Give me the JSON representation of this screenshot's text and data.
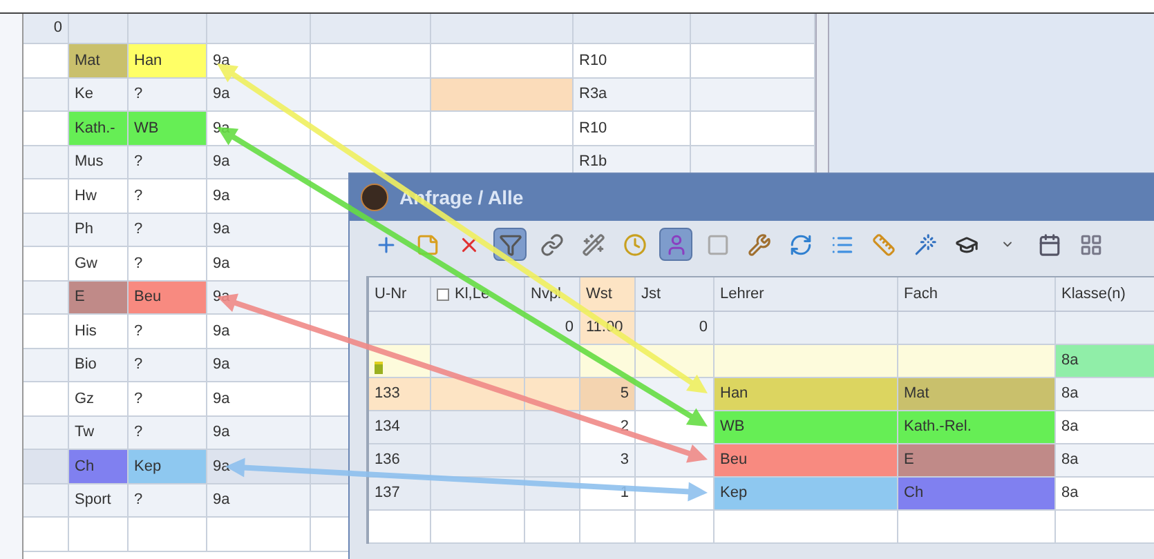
{
  "back_grid": {
    "header_first_cell": "0",
    "rows": [
      {
        "subject": {
          "text": "Mat",
          "color": "#c9c06c"
        },
        "teacher": {
          "text": "Han",
          "color": "#ffff66"
        },
        "class": "9a",
        "room": "R10",
        "selected": false
      },
      {
        "subject": {
          "text": "Ke"
        },
        "teacher": {
          "text": "?"
        },
        "class": "9a",
        "room": "R3a",
        "note_cell": {
          "color": "#fbdcba"
        },
        "selected": false
      },
      {
        "subject": {
          "text": "Kath.-",
          "color": "#66ee55"
        },
        "teacher": {
          "text": "WB",
          "color": "#66ee55"
        },
        "class": "9a",
        "room": "R10",
        "selected": false
      },
      {
        "subject": {
          "text": "Mus"
        },
        "teacher": {
          "text": "?"
        },
        "class": "9a",
        "room": "R1b",
        "selected": false
      },
      {
        "subject": {
          "text": "Hw"
        },
        "teacher": {
          "text": "?"
        },
        "class": "9a",
        "selected": false
      },
      {
        "subject": {
          "text": "Ph"
        },
        "teacher": {
          "text": "?"
        },
        "class": "9a",
        "selected": false
      },
      {
        "subject": {
          "text": "Gw"
        },
        "teacher": {
          "text": "?"
        },
        "class": "9a",
        "selected": false
      },
      {
        "subject": {
          "text": "E",
          "color": "#c08a88"
        },
        "teacher": {
          "text": "Beu",
          "color": "#f88a80"
        },
        "class": "9a",
        "selected": false
      },
      {
        "subject": {
          "text": "His"
        },
        "teacher": {
          "text": "?"
        },
        "class": "9a",
        "selected": false
      },
      {
        "subject": {
          "text": "Bio"
        },
        "teacher": {
          "text": "?"
        },
        "class": "9a",
        "selected": false
      },
      {
        "subject": {
          "text": "Gz"
        },
        "teacher": {
          "text": "?"
        },
        "class": "9a",
        "selected": false
      },
      {
        "subject": {
          "text": "Tw"
        },
        "teacher": {
          "text": "?"
        },
        "class": "9a",
        "selected": false
      },
      {
        "subject": {
          "text": "Ch",
          "color": "#8080f0"
        },
        "teacher": {
          "text": "Kep",
          "color": "#8ec8f0"
        },
        "class": "9a",
        "selected": true
      },
      {
        "subject": {
          "text": "Sport"
        },
        "teacher": {
          "text": "?"
        },
        "class": "9a",
        "selected": false
      },
      {}
    ]
  },
  "window": {
    "title": "Anfrage / Alle",
    "toolbar": [
      {
        "kind": "add",
        "selected": false
      },
      {
        "kind": "note",
        "selected": false
      },
      {
        "kind": "delete",
        "selected": false
      },
      {
        "kind": "filter",
        "selected": true
      },
      {
        "kind": "link",
        "selected": false
      },
      {
        "kind": "wand",
        "selected": false
      },
      {
        "kind": "clock",
        "selected": false
      },
      {
        "kind": "person",
        "selected": true
      },
      {
        "kind": "window",
        "selected": false
      },
      {
        "kind": "tool",
        "selected": false
      },
      {
        "kind": "refresh",
        "selected": false
      },
      {
        "kind": "list",
        "selected": false
      },
      {
        "kind": "ruler",
        "selected": false
      },
      {
        "kind": "wizard",
        "selected": false
      },
      {
        "kind": "hat",
        "selected": false
      },
      {
        "kind": "dropdown",
        "selected": false
      },
      {
        "kind": "calendar",
        "selected": false
      },
      {
        "kind": "grid",
        "selected": false
      }
    ],
    "table": {
      "columns": [
        "U-Nr",
        "Kl,Le",
        "Nvpl",
        "Wst",
        "Jst",
        "Lehrer",
        "Fach",
        "Klasse(n)"
      ],
      "summary": {
        "nvpl": "0",
        "wst": "11.00",
        "jst": "0"
      },
      "new_row": {
        "klasse": "8a"
      },
      "rows": [
        {
          "u_nr": "133",
          "wst": "5",
          "lehrer": {
            "text": "Han",
            "color": "#dcd560"
          },
          "fach": {
            "text": "Mat",
            "color": "#c9c06c"
          },
          "klasse": "8a",
          "selected": true
        },
        {
          "u_nr": "134",
          "wst": "2",
          "lehrer": {
            "text": "WB",
            "color": "#66ee55"
          },
          "fach": {
            "text": "Kath.-Rel.",
            "color": "#66ee55"
          },
          "klasse": "8a",
          "selected": false
        },
        {
          "u_nr": "136",
          "wst": "3",
          "lehrer": {
            "text": "Beu",
            "color": "#f88a80"
          },
          "fach": {
            "text": "E",
            "color": "#c08a88"
          },
          "klasse": "8a",
          "selected": false
        },
        {
          "u_nr": "137",
          "wst": "1",
          "lehrer": {
            "text": "Kep",
            "color": "#8ec8f0"
          },
          "fach": {
            "text": "Ch",
            "color": "#8080f0"
          },
          "klasse": "8a",
          "selected": false
        }
      ]
    }
  },
  "arrows": [
    {
      "color": "#f0f060"
    },
    {
      "color": "#66dd44"
    },
    {
      "color": "#f08a88"
    },
    {
      "color": "#8ec0ee"
    }
  ]
}
